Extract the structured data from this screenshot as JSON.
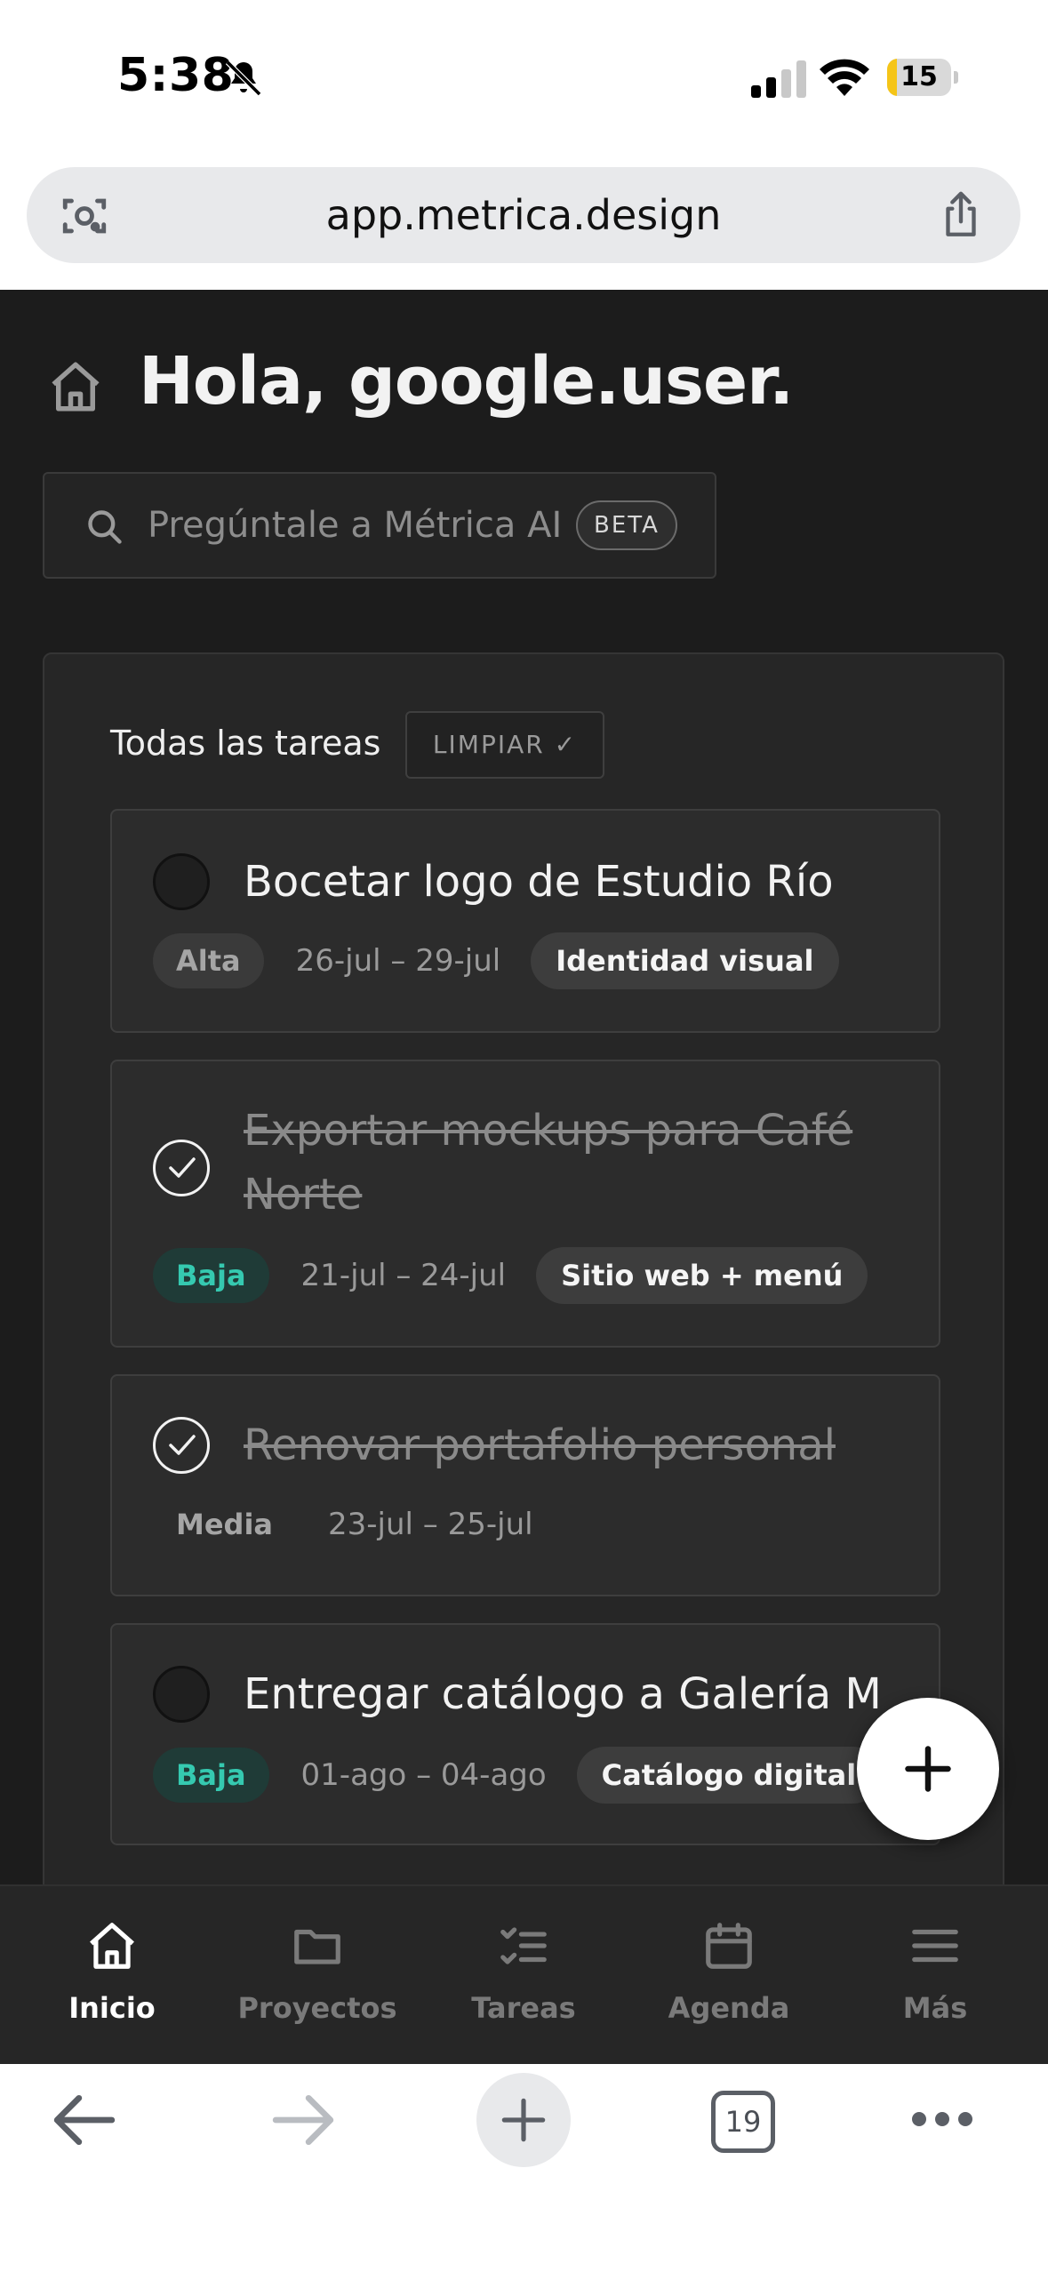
{
  "status_bar": {
    "time": "5:38",
    "battery": "15",
    "battery_level": 0.15
  },
  "browser": {
    "url": "app.metrica.design",
    "tab_count": "19"
  },
  "header": {
    "greeting": "Hola, google.user."
  },
  "search": {
    "placeholder": "Pregúntale a Métrica AI",
    "badge": "BETA"
  },
  "tasks_panel": {
    "title": "Todas las tareas",
    "clear_label": "LIMPIAR ✓",
    "tasks": [
      {
        "title": "Bocetar logo de Estudio Río",
        "done": false,
        "priority": "Alta",
        "dates": "26-jul – 29-jul",
        "project": "Identidad visual"
      },
      {
        "title": "Exportar mockups para Café Norte",
        "done": true,
        "priority": "Baja",
        "dates": "21-jul – 24-jul",
        "project": "Sitio web + menú"
      },
      {
        "title": "Renovar portafolio personal",
        "done": true,
        "priority": "Media",
        "dates": "23-jul – 25-jul",
        "project": ""
      },
      {
        "title": "Entregar catálogo a Galería M",
        "done": false,
        "priority": "Baja",
        "dates": "01-ago – 04-ago",
        "project": "Catálogo digital"
      }
    ]
  },
  "bottom_nav": [
    {
      "label": "Inicio",
      "icon": "home-icon",
      "active": true
    },
    {
      "label": "Proyectos",
      "icon": "folder-icon",
      "active": false
    },
    {
      "label": "Tareas",
      "icon": "checklist-icon",
      "active": false
    },
    {
      "label": "Agenda",
      "icon": "calendar-icon",
      "active": false
    },
    {
      "label": "Más",
      "icon": "menu-icon",
      "active": false
    }
  ],
  "colors": {
    "app_bg": "#1c1c1c",
    "panel_bg": "#262626",
    "low_priority": "#35c9b0",
    "battery": "#f5c518"
  }
}
